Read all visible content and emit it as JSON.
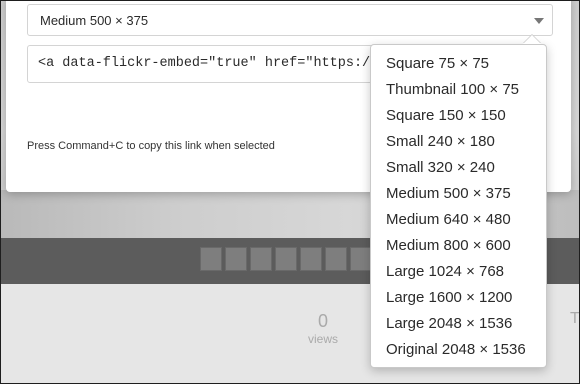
{
  "dialog": {
    "selected_size": "Medium 500 × 375",
    "embed_code": "<a data-flickr-embed=\"true\"  href=\"https://www.fl",
    "copy_hint": "Press Command+C to copy this link when selected"
  },
  "size_menu": {
    "items": [
      "Square 75 × 75",
      "Thumbnail 100 × 75",
      "Square 150 × 150",
      "Small 240 × 180",
      "Small 320 × 240",
      "Medium 500 × 375",
      "Medium 640 × 480",
      "Medium 800 × 600",
      "Large 1024 × 768",
      "Large 1600 × 1200",
      "Large 2048 × 1536",
      "Original 2048 × 1536"
    ]
  },
  "background": {
    "views_count": "0",
    "views_label": "views",
    "edge_letter": "T"
  }
}
